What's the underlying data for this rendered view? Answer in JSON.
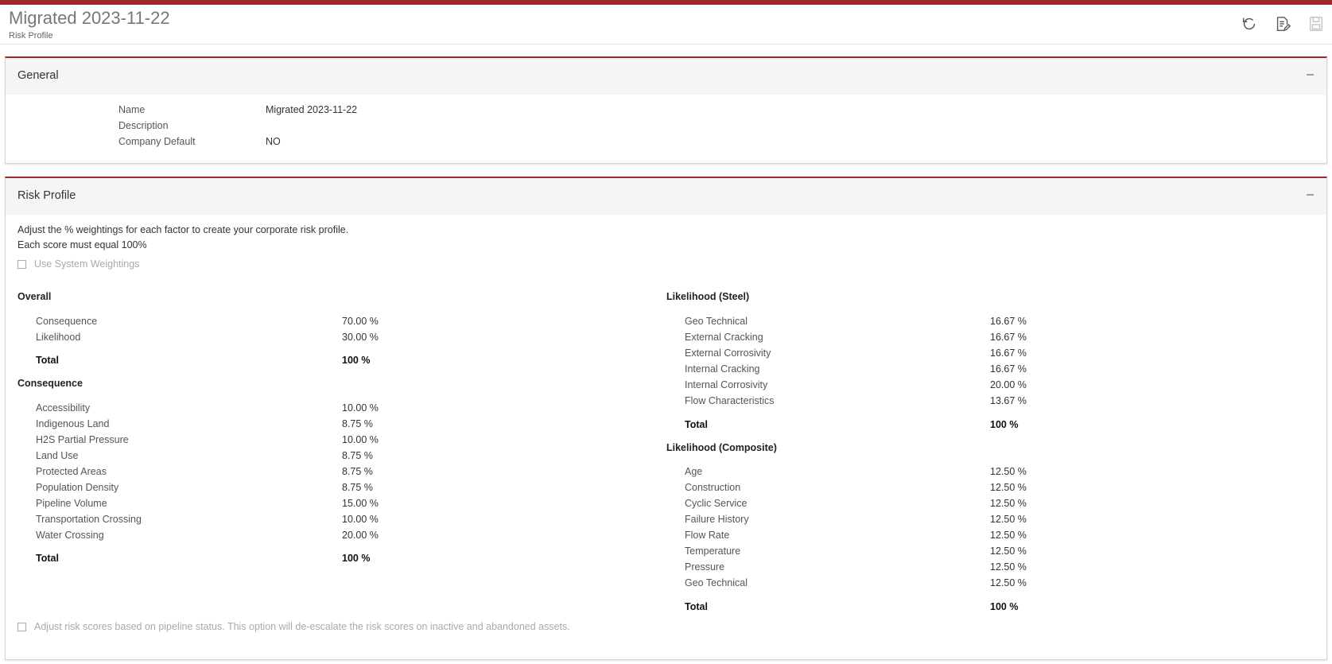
{
  "header": {
    "title": "Migrated 2023-11-22",
    "subtitle": "Risk Profile",
    "icons": [
      "refresh-icon",
      "edit-document-icon",
      "save-icon"
    ]
  },
  "general": {
    "title": "General",
    "collapse": "–",
    "fields": [
      {
        "label": "Name",
        "value": "Migrated 2023-11-22"
      },
      {
        "label": "Description",
        "value": ""
      },
      {
        "label": "Company Default",
        "value": "NO"
      }
    ]
  },
  "risk": {
    "title": "Risk Profile",
    "collapse": "–",
    "intro1": "Adjust the % weightings for each factor to create your corporate risk profile.",
    "intro2": "Each score must equal 100%",
    "use_system": "Use System Weightings",
    "adjust_note": "Adjust risk scores based on pipeline status. This option will de-escalate the risk scores on inactive and abandoned assets.",
    "overall": {
      "title": "Overall",
      "rows": [
        {
          "label": "Consequence",
          "value": "70.00 %"
        },
        {
          "label": "Likelihood",
          "value": "30.00 %"
        }
      ],
      "total_label": "Total",
      "total_value": "100 %"
    },
    "consequence": {
      "title": "Consequence",
      "rows": [
        {
          "label": "Accessibility",
          "value": "10.00 %"
        },
        {
          "label": "Indigenous Land",
          "value": "8.75 %"
        },
        {
          "label": "H2S Partial Pressure",
          "value": "10.00 %"
        },
        {
          "label": "Land Use",
          "value": "8.75 %"
        },
        {
          "label": "Protected Areas",
          "value": "8.75 %"
        },
        {
          "label": "Population Density",
          "value": "8.75 %"
        },
        {
          "label": "Pipeline Volume",
          "value": "15.00 %"
        },
        {
          "label": "Transportation Crossing",
          "value": "10.00 %"
        },
        {
          "label": "Water Crossing",
          "value": "20.00 %"
        }
      ],
      "total_label": "Total",
      "total_value": "100 %"
    },
    "steel": {
      "title": "Likelihood (Steel)",
      "rows": [
        {
          "label": "Geo Technical",
          "value": "16.67 %"
        },
        {
          "label": "External Cracking",
          "value": "16.67 %"
        },
        {
          "label": "External Corrosivity",
          "value": "16.67 %"
        },
        {
          "label": "Internal Cracking",
          "value": "16.67 %"
        },
        {
          "label": "Internal Corrosivity",
          "value": "20.00 %"
        },
        {
          "label": "Flow Characteristics",
          "value": "13.67 %"
        }
      ],
      "total_label": "Total",
      "total_value": "100 %"
    },
    "composite": {
      "title": "Likelihood (Composite)",
      "rows": [
        {
          "label": "Age",
          "value": "12.50 %"
        },
        {
          "label": "Construction",
          "value": "12.50 %"
        },
        {
          "label": "Cyclic Service",
          "value": "12.50 %"
        },
        {
          "label": "Failure History",
          "value": "12.50 %"
        },
        {
          "label": "Flow Rate",
          "value": "12.50 %"
        },
        {
          "label": "Temperature",
          "value": "12.50 %"
        },
        {
          "label": "Pressure",
          "value": "12.50 %"
        },
        {
          "label": "Geo Technical",
          "value": "12.50 %"
        }
      ],
      "total_label": "Total",
      "total_value": "100 %"
    }
  }
}
